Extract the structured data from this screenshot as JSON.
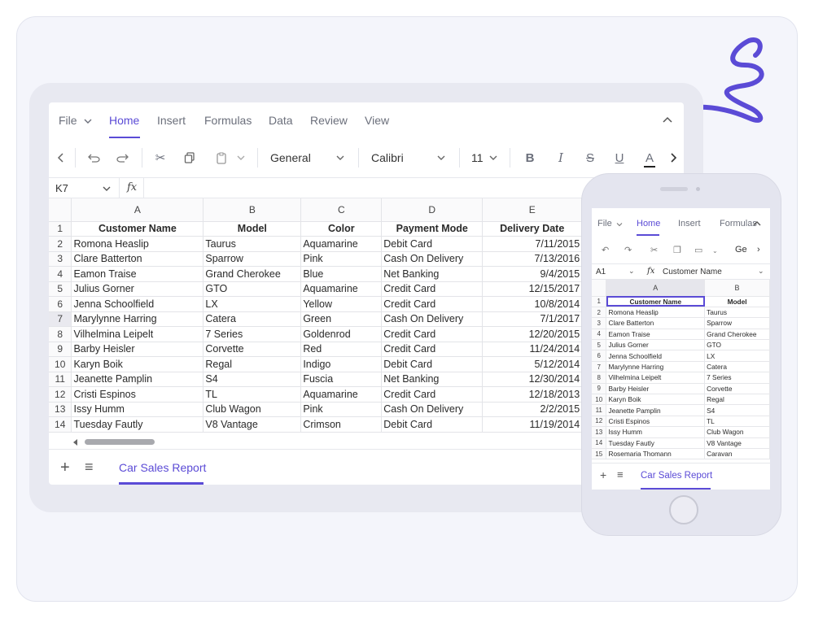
{
  "colors": {
    "accent": "#5b4bd6",
    "arrow": "#5b4bd6"
  },
  "ribbon": {
    "tabs": [
      "File",
      "Home",
      "Insert",
      "Formulas",
      "Data",
      "Review",
      "View"
    ],
    "active_tab": "Home"
  },
  "toolbar": {
    "number_format": "General",
    "font_family": "Calibri",
    "font_size": "11",
    "icons": [
      "chevron-left-icon",
      "undo-icon",
      "redo-icon",
      "cut-icon",
      "copy-icon",
      "paste-icon",
      "bold-icon",
      "italic-icon",
      "strikethrough-icon",
      "underline-icon",
      "font-color-icon",
      "chevron-right-icon"
    ],
    "bold": "B",
    "italic": "I",
    "strike": "S",
    "underline": "U",
    "font_color": "A"
  },
  "formula_bar": {
    "cell_ref": "K7",
    "fx": "fx",
    "value": ""
  },
  "sheet": {
    "columns": [
      "A",
      "B",
      "C",
      "D",
      "E"
    ],
    "headers": [
      "Customer Name",
      "Model",
      "Color",
      "Payment Mode",
      "Delivery Date"
    ],
    "rows": [
      [
        "Romona Heaslip",
        "Taurus",
        "Aquamarine",
        "Debit Card",
        "7/11/2015"
      ],
      [
        "Clare Batterton",
        "Sparrow",
        "Pink",
        "Cash On Delivery",
        "7/13/2016"
      ],
      [
        "Eamon Traise",
        "Grand Cherokee",
        "Blue",
        "Net Banking",
        "9/4/2015"
      ],
      [
        "Julius Gorner",
        "GTO",
        "Aquamarine",
        "Credit Card",
        "12/15/2017"
      ],
      [
        "Jenna Schoolfield",
        "LX",
        "Yellow",
        "Credit Card",
        "10/8/2014"
      ],
      [
        "Marylynne Harring",
        "Catera",
        "Green",
        "Cash On Delivery",
        "7/1/2017"
      ],
      [
        "Vilhelmina Leipelt",
        "7 Series",
        "Goldenrod",
        "Credit Card",
        "12/20/2015"
      ],
      [
        "Barby Heisler",
        "Corvette",
        "Red",
        "Credit Card",
        "11/24/2014"
      ],
      [
        "Karyn Boik",
        "Regal",
        "Indigo",
        "Debit Card",
        "5/12/2014"
      ],
      [
        "Jeanette Pamplin",
        "S4",
        "Fuscia",
        "Net Banking",
        "12/30/2014"
      ],
      [
        "Cristi Espinos",
        "TL",
        "Aquamarine",
        "Credit Card",
        "12/18/2013"
      ],
      [
        "Issy Humm",
        "Club Wagon",
        "Pink",
        "Cash On Delivery",
        "2/2/2015"
      ],
      [
        "Tuesday Fautly",
        "V8 Vantage",
        "Crimson",
        "Debit Card",
        "11/19/2014"
      ]
    ],
    "tab_name": "Car Sales Report"
  },
  "mobile": {
    "tabs": [
      "File",
      "Home",
      "Insert",
      "Formulas"
    ],
    "cell_ref": "A1",
    "formula_value": "Customer Name",
    "toolbar_font": "Ge",
    "columns": [
      "A",
      "B"
    ],
    "headers": [
      "Customer Name",
      "Model"
    ],
    "rows": [
      [
        "Romona Heaslip",
        "Taurus"
      ],
      [
        "Clare Batterton",
        "Sparrow"
      ],
      [
        "Eamon Traise",
        "Grand Cherokee"
      ],
      [
        "Julius Gorner",
        "GTO"
      ],
      [
        "Jenna Schoolfield",
        "LX"
      ],
      [
        "Marylynne Harring",
        "Catera"
      ],
      [
        "Vilhelmina Leipelt",
        "7 Series"
      ],
      [
        "Barby Heisler",
        "Corvette"
      ],
      [
        "Karyn Boik",
        "Regal"
      ],
      [
        "Jeanette Pamplin",
        "S4"
      ],
      [
        "Cristi Espinos",
        "TL"
      ],
      [
        "Issy Humm",
        "Club Wagon"
      ],
      [
        "Tuesday Fautly",
        "V8 Vantage"
      ],
      [
        "Rosemaria Thomann",
        "Caravan"
      ]
    ],
    "tab_name": "Car Sales Report"
  }
}
